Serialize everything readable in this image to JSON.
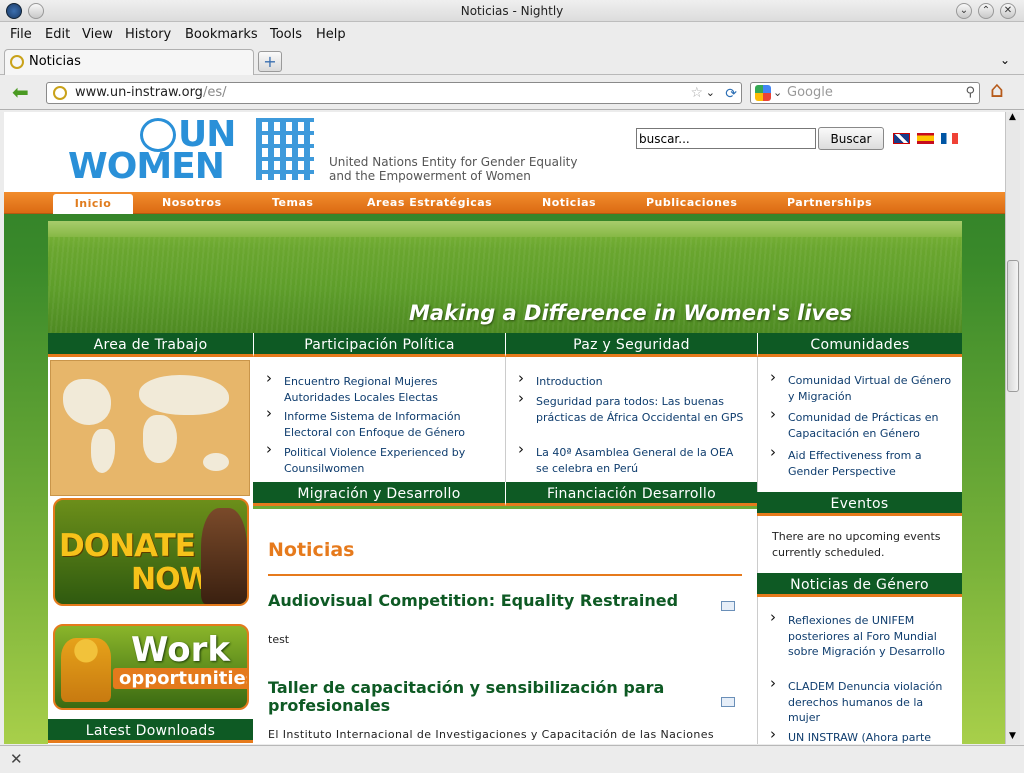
{
  "window": {
    "title": "Noticias - Nightly"
  },
  "menu": [
    "File",
    "Edit",
    "View",
    "History",
    "Bookmarks",
    "Tools",
    "Help"
  ],
  "tab": {
    "label": "Noticias"
  },
  "address": {
    "host": "www.un-instraw.org",
    "path": "/es/"
  },
  "search_engine": {
    "placeholder": "Google"
  },
  "site": {
    "logo_top": "UN",
    "logo_bottom": "WOMEN",
    "tagline1": "United Nations Entity for Gender Equality",
    "tagline2": "and the Empowerment of Women",
    "search_value": "buscar...",
    "search_button": "Buscar",
    "nav": [
      "Inicio",
      "Nosotros",
      "Temas",
      "Areas Estratégicas",
      "Noticias",
      "Publicaciones",
      "Partnerships"
    ],
    "banner": "Making a Difference in Women's lives",
    "left": {
      "heading": "Area de Trabajo",
      "donate1": "DONATE",
      "donate2": "NOW",
      "work1": "Work",
      "work2": "opportunities",
      "downloads": "Latest Downloads"
    },
    "participacion": {
      "heading": "Participación Política",
      "items": [
        "Encuentro Regional Mujeres Autoridades Locales Electas",
        "Informe Sistema de Información Electoral con Enfoque de Género",
        "Political Violence Experienced by Counsilwomen"
      ]
    },
    "paz": {
      "heading": "Paz y Seguridad",
      "items": [
        "Introduction",
        "Seguridad para todos: Las buenas prácticas de África Occidental en GPS",
        "La 40ª Asamblea General de la OEA se celebra en Perú"
      ]
    },
    "migracion": {
      "heading": "Migración y Desarrollo"
    },
    "financiacion": {
      "heading": "Financiación Desarrollo"
    },
    "comunidades": {
      "heading": "Comunidades",
      "items": [
        "Comunidad Virtual de Género y Migración",
        "Comunidad de Prácticas en Capacitación en Género",
        "Aid Effectiveness from a Gender Perspective"
      ]
    },
    "eventos": {
      "heading": "Eventos",
      "text": "There are no upcoming events currently scheduled."
    },
    "noticias_genero": {
      "heading": "Noticias de Género",
      "items": [
        "Reflexiones de UNIFEM posteriores al Foro Mundial sobre Migración y Desarrollo",
        "CLADEM Denuncia violación derechos humanos de la mujer",
        "UN INSTRAW (Ahora parte"
      ]
    },
    "noticias": {
      "heading": "Noticias",
      "articles": [
        {
          "title": "Audiovisual Competition: Equality Restrained",
          "body": "test"
        },
        {
          "title": "Taller de capacitación y sensibilización para profesionales",
          "body": "El Instituto Internacional de Investigaciones y Capacitación de las Naciones"
        }
      ]
    }
  }
}
